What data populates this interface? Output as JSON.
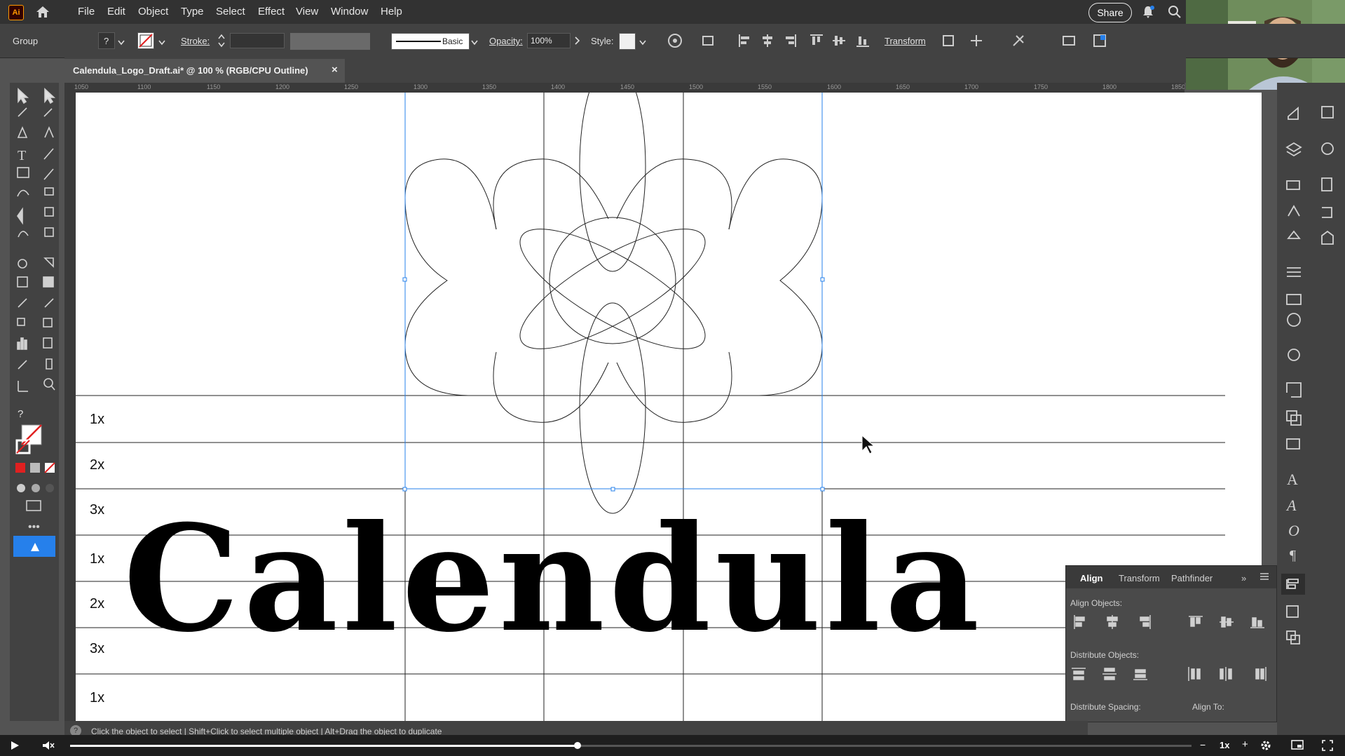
{
  "app": {
    "logo": "Ai"
  },
  "menu": [
    "File",
    "Edit",
    "Object",
    "Type",
    "Select",
    "Effect",
    "View",
    "Window",
    "Help"
  ],
  "header": {
    "share": "Share"
  },
  "control": {
    "selection": "Group",
    "stroke_label": "Stroke:",
    "brush": "Basic",
    "opacity_label": "Opacity:",
    "opacity_value": "100%",
    "style_label": "Style:",
    "transform": "Transform"
  },
  "document": {
    "tab_title": "Calendula_Logo_Draft.ai* @ 100 % (RGB/CPU Outline)",
    "close": "×"
  },
  "ruler": {
    "top": [
      "1050",
      "1100",
      "1150",
      "1200",
      "1250",
      "1300",
      "1350",
      "1400",
      "1450",
      "1500",
      "1550",
      "1600",
      "1650",
      "1700",
      "1750",
      "1800",
      "1850"
    ]
  },
  "canvas": {
    "row_labels": [
      "1x",
      "2x",
      "3x",
      "1x",
      "2x",
      "3x",
      "1x"
    ],
    "wordmark": "Calendula"
  },
  "align_panel": {
    "tabs": [
      "Align",
      "Transform",
      "Pathfinder"
    ],
    "align_objects": "Align Objects:",
    "distribute_objects": "Distribute Objects:",
    "distribute_spacing": "Distribute Spacing:",
    "align_to": "Align To:"
  },
  "status": {
    "hint": "Click the object to select  |  Shift+Click to select multiple object  |  Alt+Drag the object to duplicate"
  },
  "player": {
    "speed": "1x"
  },
  "colors": {
    "accent": "#2680eb",
    "canvas": "#ffffff",
    "ui_dark": "#323232",
    "ui_mid": "#424242"
  }
}
